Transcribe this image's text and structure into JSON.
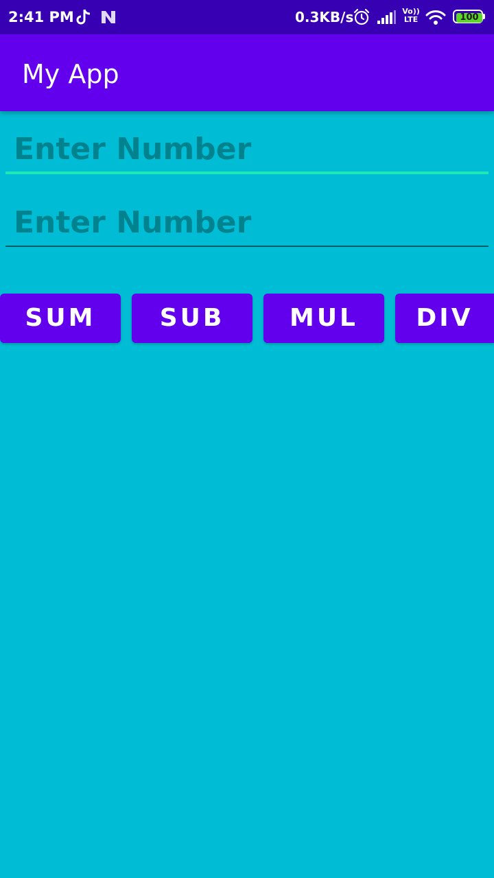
{
  "status_bar": {
    "time": "2:41 PM",
    "net_speed": "0.3KB/s",
    "volte_top": "Vo))",
    "volte_bottom": "LTE",
    "battery_level": "100",
    "icons": [
      "tiktok-icon",
      "n-icon",
      "alarm-icon",
      "signal-icon",
      "volte-icon",
      "wifi-icon",
      "battery-icon"
    ],
    "background": "#3700B3"
  },
  "app_bar": {
    "title": "My App",
    "background": "#6200EE"
  },
  "inputs": [
    {
      "placeholder": "Enter Number",
      "value": ""
    },
    {
      "placeholder": "Enter Number",
      "value": ""
    }
  ],
  "buttons": [
    {
      "label": "SUM"
    },
    {
      "label": "SUB"
    },
    {
      "label": "MUL"
    },
    {
      "label": "DIV"
    }
  ],
  "colors": {
    "page_background": "#00BCD4",
    "accent": "#1DE9B6",
    "button": "#6200EE",
    "hint_text": "#00838F"
  }
}
